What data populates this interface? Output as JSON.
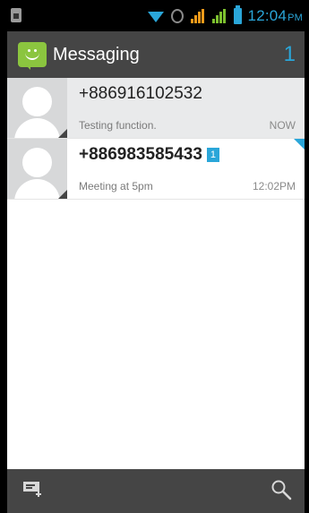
{
  "status_bar": {
    "time": "12:04",
    "ampm": "PM",
    "icons": [
      "sim-icon",
      "wifi-icon",
      "data-sync-icon",
      "signal-orange-icon",
      "signal-green-icon",
      "battery-icon"
    ]
  },
  "action_bar": {
    "title": "Messaging",
    "unread_count": "1",
    "icon": "messaging-app-icon"
  },
  "threads": [
    {
      "sender": "+886916102532",
      "snippet": "Testing function.",
      "time": "NOW",
      "unread": false,
      "badge": ""
    },
    {
      "sender": "+886983585433",
      "snippet": "Meeting at 5pm",
      "time": "12:02PM",
      "unread": true,
      "badge": "1"
    }
  ],
  "bottom_bar": {
    "actions": [
      "compose-new-message-icon",
      "search-icon"
    ]
  },
  "colors": {
    "accent": "#2aa6d9",
    "action_bar": "#454545",
    "app_icon": "#8bc53f",
    "read_row": "#e9eaeb"
  }
}
